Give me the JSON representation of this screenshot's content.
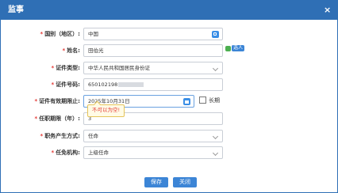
{
  "dialog": {
    "title": "监事",
    "close_symbol": "×"
  },
  "form": {
    "country": {
      "required": "*",
      "label": "国别（地区）:",
      "value": "中国"
    },
    "name": {
      "required": "*",
      "label": "姓名:",
      "value": "田伯光",
      "select_button": "选人"
    },
    "id_type": {
      "required": "*",
      "label": "证件类型:",
      "value": "中华人民共和国居民身份证"
    },
    "id_number": {
      "required": "*",
      "label": "证件号码:",
      "value": "650102198"
    },
    "id_validity": {
      "required": "*",
      "label": "证件有效期限止:",
      "value": "2025年10月31日",
      "long_term_label": "长期"
    },
    "tenure": {
      "required": "*",
      "label": "任职期限（年）:",
      "value": "3"
    },
    "appointment_method": {
      "required": "*",
      "label": "职务产生方式:",
      "value": "任命"
    },
    "appointing_body": {
      "required": "*",
      "label": "任免机构:",
      "value": "上级任命"
    }
  },
  "tooltip": {
    "text": "不可以为空!"
  },
  "buttons": {
    "save": "保存",
    "close": "关闭"
  }
}
